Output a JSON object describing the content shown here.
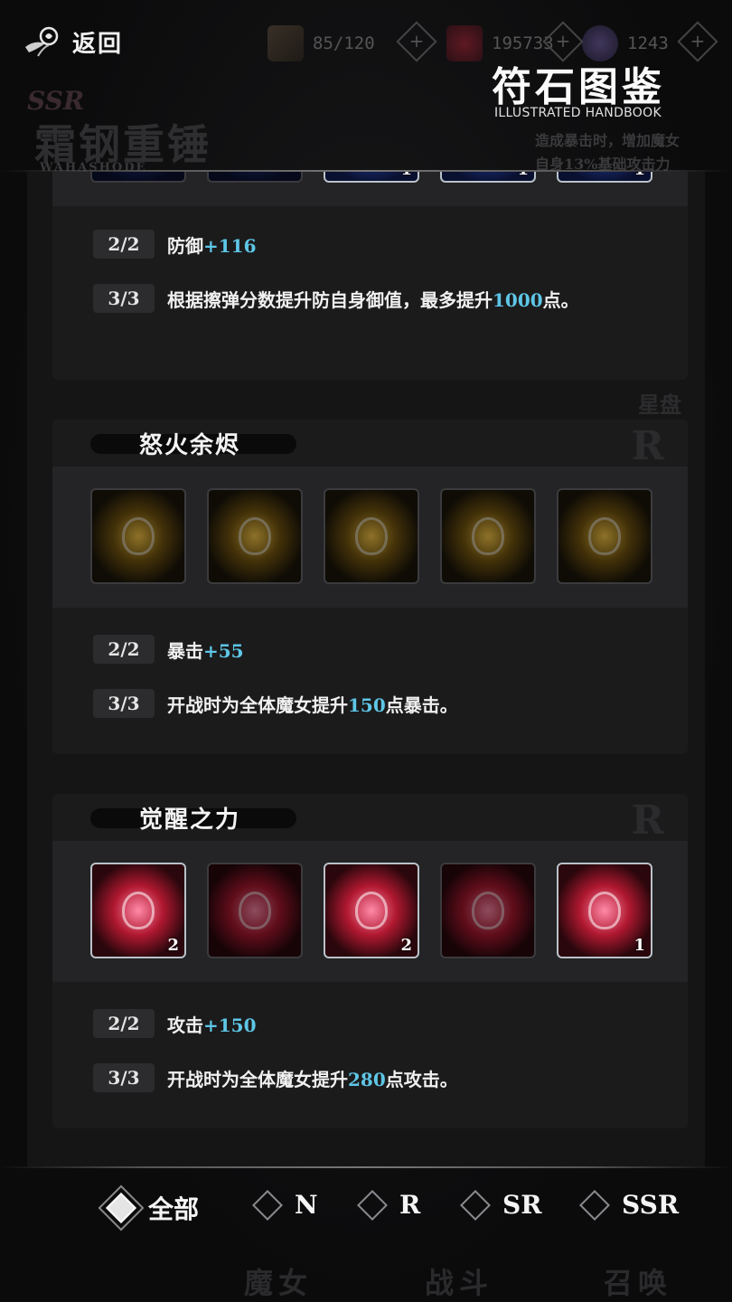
{
  "header": {
    "back_label": "返回",
    "resources": [
      {
        "icon": "card-icon",
        "value": "85/120"
      },
      {
        "icon": "crystal-icon",
        "value": "195733"
      },
      {
        "icon": "orb-icon",
        "value": "1243"
      }
    ],
    "handbook_title": "符石图鉴",
    "handbook_subtitle": "ILLUSTRATED HANDBOOK"
  },
  "background": {
    "rarity_tag": "SSR",
    "weapon_name": "霜钢重锤",
    "weapon_sub": "WAHASHODE",
    "desc_line1": "造成暴击时，增加魔女",
    "desc_line2": "自身13%基础攻击力",
    "star_label": "星盘"
  },
  "sets": [
    {
      "name": "",
      "rarity": "",
      "slots": [
        {
          "color": "blue",
          "lit": false,
          "count": ""
        },
        {
          "color": "blue",
          "lit": false,
          "count": ""
        },
        {
          "color": "blue",
          "lit": true,
          "count": "1"
        },
        {
          "color": "blue",
          "lit": true,
          "count": "1"
        },
        {
          "color": "blue",
          "lit": true,
          "count": "1"
        }
      ],
      "effects": [
        {
          "tier": "2/2",
          "text": "防御",
          "hl": "+116",
          "tail": ""
        },
        {
          "tier": "3/3",
          "text": "根据擦弹分数提升防自身御值，最多提升",
          "hl": "1000",
          "tail": "点。"
        }
      ]
    },
    {
      "name": "怒火余烬",
      "rarity": "R",
      "slots": [
        {
          "color": "gold",
          "lit": false,
          "count": ""
        },
        {
          "color": "gold",
          "lit": false,
          "count": ""
        },
        {
          "color": "gold",
          "lit": false,
          "count": ""
        },
        {
          "color": "gold",
          "lit": false,
          "count": ""
        },
        {
          "color": "gold",
          "lit": false,
          "count": ""
        }
      ],
      "effects": [
        {
          "tier": "2/2",
          "text": "暴击",
          "hl": "+55",
          "tail": ""
        },
        {
          "tier": "3/3",
          "text": "开战时为全体魔女提升",
          "hl": "150",
          "tail": "点暴击。"
        }
      ]
    },
    {
      "name": "觉醒之力",
      "rarity": "R",
      "slots": [
        {
          "color": "red",
          "lit": true,
          "count": "2"
        },
        {
          "color": "red",
          "lit": false,
          "count": ""
        },
        {
          "color": "red",
          "lit": true,
          "count": "2"
        },
        {
          "color": "red",
          "lit": false,
          "count": ""
        },
        {
          "color": "red",
          "lit": true,
          "count": "1"
        }
      ],
      "effects": [
        {
          "tier": "2/2",
          "text": "攻击",
          "hl": "+150",
          "tail": ""
        },
        {
          "tier": "3/3",
          "text": "开战时为全体魔女提升",
          "hl": "280",
          "tail": "点攻击。"
        }
      ]
    }
  ],
  "filters": [
    {
      "label": "全部",
      "selected": true
    },
    {
      "label": "N",
      "selected": false
    },
    {
      "label": "R",
      "selected": false
    },
    {
      "label": "SR",
      "selected": false
    },
    {
      "label": "SSR",
      "selected": false
    }
  ],
  "nav_ghost": [
    "魔女",
    "战斗",
    "召唤"
  ],
  "colors": {
    "highlight": "#5ec6e6",
    "background": "#0b0b0c",
    "card": "#1b1b1c"
  }
}
